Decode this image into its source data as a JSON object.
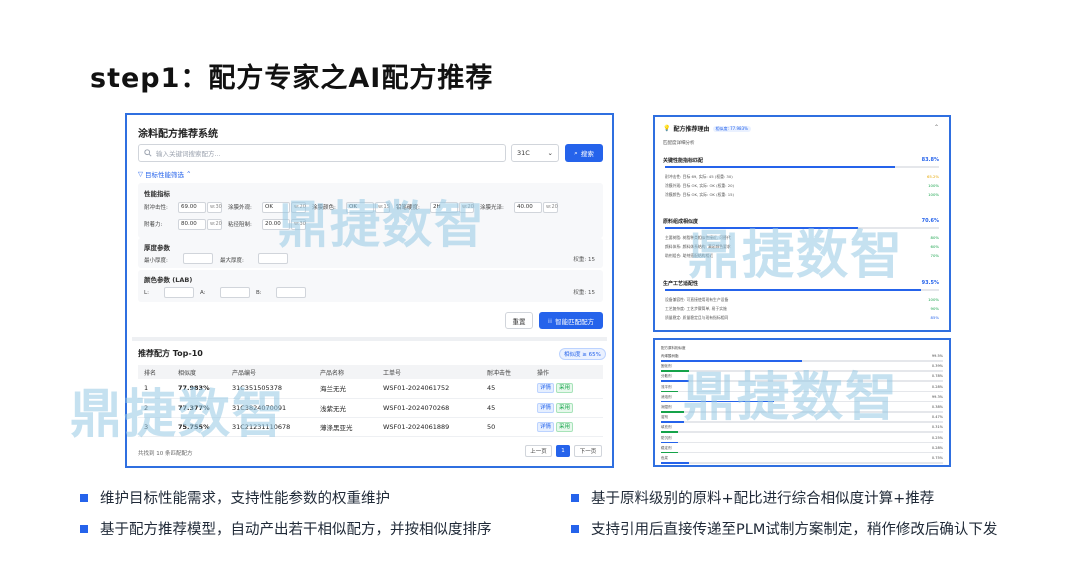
{
  "slide": {
    "title": "step1：配方专家之AI配方推荐"
  },
  "watermark": "鼎捷数智",
  "main": {
    "system_title": "涂料配方推荐系统",
    "search_placeholder": "输入关键词搜索配方...",
    "select_value": "31C",
    "search_button": "搜索",
    "filter_toggle": "目标性能筛选",
    "perf": {
      "title": "性能指标",
      "fields": [
        {
          "label": "耐冲击性:",
          "value": "69.00",
          "w": "w:30"
        },
        {
          "label": "涂膜外观:",
          "value": "OK",
          "w": "w:20"
        },
        {
          "label": "涂膜颜色:",
          "value": "OK",
          "w": "w:15"
        },
        {
          "label": "铅笔硬度:",
          "value": "2H",
          "w": "w:20"
        },
        {
          "label": "涂膜光泽:",
          "value": "40.00",
          "w": "w:20"
        },
        {
          "label": "附着力:",
          "value": "80.00",
          "w": "w:20"
        },
        {
          "label": "粘径阻制:",
          "value": "20.00",
          "w": "w:30"
        }
      ]
    },
    "thickness": {
      "title": "厚度参数",
      "min_label": "最小厚度:",
      "max_label": "最大厚度:",
      "weight": "权重: 15"
    },
    "color": {
      "title": "颜色参数 (LAB)",
      "l": "L:",
      "a": "A:",
      "b": "B:",
      "weight": "权重: 15"
    },
    "reset_button": "重置",
    "match_button": "智能匹配配方",
    "rec_title": "推荐配方 Top-10",
    "rec_badge": "相似度 ≥ 65%",
    "table": {
      "headers": [
        "排名",
        "相似度",
        "产品编号",
        "产品名称",
        "工单号",
        "耐冲击性",
        "操作"
      ],
      "rows": [
        {
          "rank": "1",
          "sim": "77.983%",
          "code": "31C351505378",
          "name": "海兰无光",
          "order": "WSF01-2024061752",
          "impact": "45"
        },
        {
          "rank": "2",
          "sim": "77.377%",
          "code": "31C3824070091",
          "name": "浅紫无光",
          "order": "WSF01-2024070268",
          "impact": "45"
        },
        {
          "rank": "3",
          "sim": "75.755%",
          "code": "31C21231110678",
          "name": "薄涤黑亚光",
          "order": "WSF01-2024061889",
          "impact": "50"
        }
      ],
      "detail_tag": "详情",
      "use_tag": "采用"
    },
    "total_note": "共找到 10 条匹配配方",
    "prev": "上一页",
    "page": "1",
    "next": "下一页"
  },
  "right_top": {
    "title": "配方推荐理由",
    "pill": "相似度: 77.983%",
    "sub": "匹配度详细分析",
    "sections": [
      {
        "title": "关键性能指标匹配",
        "value": "83.8%",
        "fill": 0.838,
        "rows": [
          {
            "label": "耐冲击性: 目标 69, 实际: 45 (权重: 30)",
            "val": "65.2%",
            "color": "#e6a700"
          },
          {
            "label": "涂膜外观: 目标 OK, 实际: OK (权重: 20)",
            "val": "100%",
            "color": "#16a34a"
          },
          {
            "label": "涂膜颜色: 目标 OK, 实际: OK (权重: 15)",
            "val": "100%",
            "color": "#16a34a"
          }
        ]
      },
      {
        "title": "原料组成相似度",
        "value": "70.6%",
        "fill": 0.706,
        "rows": [
          {
            "label": "主要树脂: 树脂种类相似性接近, 可替代",
            "val": "80%",
            "color": "#16a34a"
          },
          {
            "label": "颜料体系: 颜料体系结构, 满足颜色要求",
            "val": "60%",
            "color": "#16a34a"
          },
          {
            "label": "助剂组合: 助剂搭配结构相近",
            "val": "70%",
            "color": "#16a34a"
          }
        ]
      },
      {
        "title": "生产工艺适配性",
        "value": "93.5%",
        "fill": 0.935,
        "rows": [
          {
            "label": "设备兼容性: 可直接使用现有生产设备",
            "val": "100%",
            "color": "#16a34a"
          },
          {
            "label": "工艺复杂度: 工艺步骤简单, 易于实施",
            "val": "90%",
            "color": "#16a34a"
          },
          {
            "label": "质量稳定: 质量稳定且与现有指标相同",
            "val": "85%",
            "color": "#2563eb"
          }
        ]
      }
    ]
  },
  "right_bottom": {
    "head": "配方原料相似度",
    "rows": [
      {
        "label": "丙烯酸树脂",
        "val": "99.5%",
        "fill": 0.5,
        "color": "#2563eb"
      },
      {
        "label": "固化剂",
        "val": "0.39%",
        "fill": 0.1,
        "color": "#16a34a"
      },
      {
        "label": "分散剂",
        "val": "0.78%",
        "fill": 0.1,
        "color": "#2563eb"
      },
      {
        "label": "流平剂",
        "val": "0.28%",
        "fill": 0.06,
        "color": "#16a34a"
      },
      {
        "label": "消泡剂",
        "val": "99.3%",
        "fill": 0.4,
        "color": "#2563eb"
      },
      {
        "label": "润湿剂",
        "val": "0.38%",
        "fill": 0.08,
        "color": "#16a34a"
      },
      {
        "label": "溶剂",
        "val": "0.47%",
        "fill": 0.08,
        "color": "#2563eb"
      },
      {
        "label": "填充剂",
        "val": "0.31%",
        "fill": 0.06,
        "color": "#16a34a"
      },
      {
        "label": "防沉剂",
        "val": "0.25%",
        "fill": 0.06,
        "color": "#2563eb"
      },
      {
        "label": "稳定剂",
        "val": "0.28%",
        "fill": 0.06,
        "color": "#16a34a"
      },
      {
        "label": "色浆",
        "val": "0.75%",
        "fill": 0.1,
        "color": "#2563eb"
      }
    ]
  },
  "bullets": [
    "维护目标性能需求，支持性能参数的权重维护",
    "基于原料级别的原料+配比进行综合相似度计算+推荐",
    "基于配方推荐模型，自动产出若干相似配方，并按相似度排序",
    "支持引用后直接传递至PLM试制方案制定，稍作修改后确认下发"
  ]
}
